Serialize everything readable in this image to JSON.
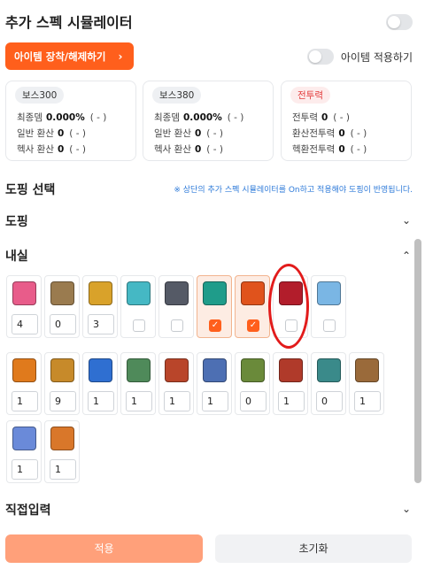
{
  "header": {
    "title": "추가 스펙 시뮬레이터"
  },
  "equip_button": {
    "label": "아이템 장착/해제하기",
    "chevron": "›"
  },
  "apply_items": {
    "label": "아이템 적용하기"
  },
  "cards": [
    {
      "chip": "보스300",
      "rows": [
        {
          "label": "최종뎀",
          "value": "0.000%",
          "paren": "( - )"
        },
        {
          "label": "일반 환산",
          "value": "0",
          "paren": "( - )"
        },
        {
          "label": "헥사 환산",
          "value": "0",
          "paren": "( - )"
        }
      ]
    },
    {
      "chip": "보스380",
      "rows": [
        {
          "label": "최종뎀",
          "value": "0.000%",
          "paren": "( - )"
        },
        {
          "label": "일반 환산",
          "value": "0",
          "paren": "( - )"
        },
        {
          "label": "헥사 환산",
          "value": "0",
          "paren": "( - )"
        }
      ]
    },
    {
      "chip": "전투력",
      "rows": [
        {
          "label": "전투력",
          "value": "0",
          "paren": "( - )"
        },
        {
          "label": "환산전투력",
          "value": "0",
          "paren": "( - )"
        },
        {
          "label": "헥환전투력",
          "value": "0",
          "paren": "( - )"
        }
      ]
    }
  ],
  "doping_select": {
    "title": "도핑 선택",
    "hint": "※ 상단의 추가 스펙 시뮬레이터를 On하고 적용해야 도핑이 반영됩니다."
  },
  "sections": {
    "doping": "도핑",
    "inner": "내실",
    "direct": "직접입력"
  },
  "row1": [
    {
      "name": "pink-potion-icon",
      "color": "#e85c8a",
      "kind": "num",
      "value": "4"
    },
    {
      "name": "brown-potion-icon",
      "color": "#9a7b4f",
      "kind": "num",
      "value": "0"
    },
    {
      "name": "gold-potion-icon",
      "color": "#d9a22a",
      "kind": "num",
      "value": "3"
    },
    {
      "name": "teal-blob-icon",
      "color": "#45b8c4",
      "kind": "chk",
      "checked": false
    },
    {
      "name": "character-icon",
      "color": "#555a66",
      "kind": "chk",
      "checked": false
    },
    {
      "name": "green-flame-icon",
      "color": "#1f9c8a",
      "kind": "chk",
      "checked": true
    },
    {
      "name": "maple-leaf-icon",
      "color": "#e0531c",
      "kind": "chk",
      "checked": true
    },
    {
      "name": "red-crown-icon",
      "color": "#b21d2b",
      "kind": "chk",
      "checked": false
    },
    {
      "name": "snowflake-icon",
      "color": "#7ab6e4",
      "kind": "chk",
      "checked": false
    }
  ],
  "row2": [
    {
      "name": "orange-burst-icon",
      "color": "#e07a1c",
      "value": "1"
    },
    {
      "name": "gold-sword-icon",
      "color": "#c78a2a",
      "value": "9"
    },
    {
      "name": "blue-orb-icon",
      "color": "#2f6fd1",
      "value": "1"
    },
    {
      "name": "green-statue-icon",
      "color": "#4f8a5a",
      "value": "1"
    },
    {
      "name": "red-mask-icon",
      "color": "#b9452a",
      "value": "1"
    },
    {
      "name": "blue-armor-icon",
      "color": "#4d6fb3",
      "value": "1"
    },
    {
      "name": "green-banner-icon",
      "color": "#6a8a3a",
      "value": "0"
    },
    {
      "name": "red-pillar-icon",
      "color": "#b03a2a",
      "value": "1"
    },
    {
      "name": "teal-tower-icon",
      "color": "#3a8a8a",
      "value": "0"
    },
    {
      "name": "bronze-tower-icon",
      "color": "#9a6a3a",
      "value": "1"
    }
  ],
  "row3": [
    {
      "name": "blue-crystal-icon",
      "color": "#6a8ad9",
      "value": "1"
    },
    {
      "name": "orange-stone-icon",
      "color": "#d9772a",
      "value": "1"
    }
  ],
  "footer": {
    "apply": "적용",
    "reset": "초기화"
  }
}
